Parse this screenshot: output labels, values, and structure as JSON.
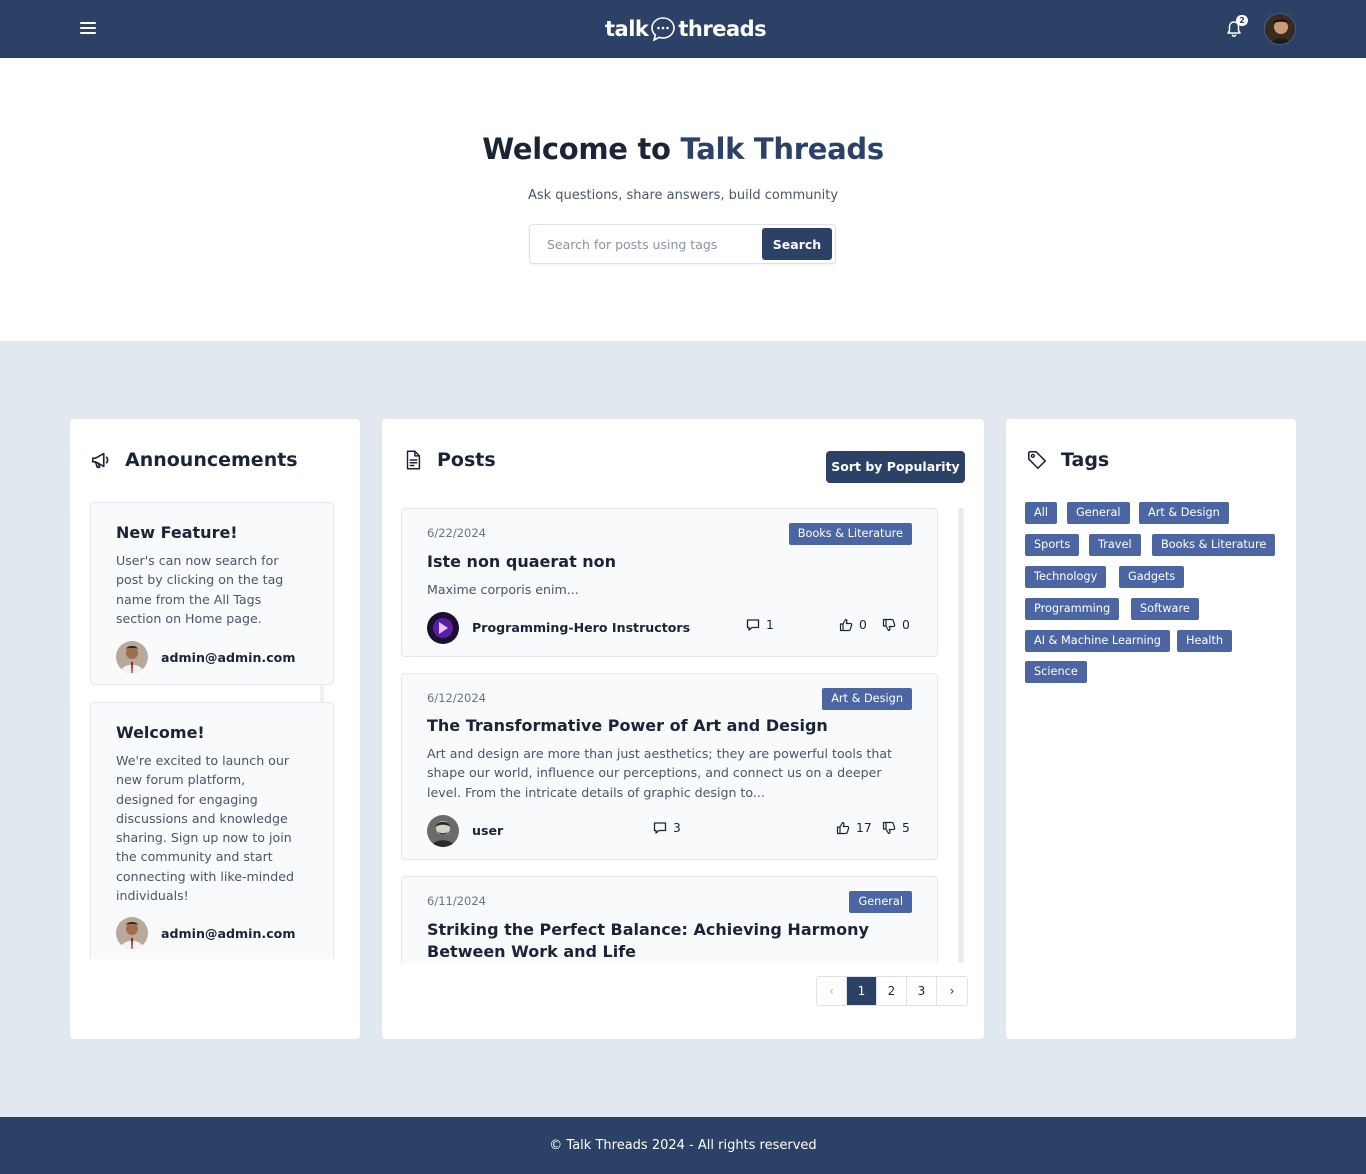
{
  "header": {
    "brand_left": "talk",
    "brand_right": "threads",
    "notification_count": "2",
    "icons": {
      "menu": "hamburger-menu-icon",
      "bell": "bell-icon"
    }
  },
  "hero": {
    "title_prefix": "Welcome to",
    "title_accent": "Talk Threads",
    "subtitle": "Ask questions, share answers, build community",
    "search_placeholder": "Search for posts using tags",
    "search_button": "Search"
  },
  "announcements": {
    "heading": "Announcements",
    "icon": "megaphone-icon",
    "items": [
      {
        "title": "New Feature!",
        "body": "User's can now search for post by clicking on the tag name from the All Tags section on Home page.",
        "author": "admin@admin.com"
      },
      {
        "title": "Welcome!",
        "body": "We're excited to launch our new forum platform, designed for engaging discussions and knowledge sharing. Sign up now to join the community and start connecting with like-minded individuals!",
        "author": "admin@admin.com"
      }
    ]
  },
  "posts": {
    "heading": "Posts",
    "icon": "document-icon",
    "sort_button": "Sort by Popularity",
    "items": [
      {
        "date": "6/22/2024",
        "tag": "Books & Literature",
        "title": "Iste non quaerat non",
        "excerpt": "Maxime corporis enim...",
        "author": "Programming-Hero Instructors",
        "comments": "1",
        "upvotes": "0",
        "downvotes": "0"
      },
      {
        "date": "6/12/2024",
        "tag": "Art & Design",
        "title": "The Transformative Power of Art and Design",
        "excerpt": "Art and design are more than just aesthetics; they are powerful tools that shape our world, influence our perceptions, and connect us on a deeper level. From the intricate details of graphic design to...",
        "author": "user",
        "comments": "3",
        "upvotes": "17",
        "downvotes": "5"
      },
      {
        "date": "6/11/2024",
        "tag": "General",
        "title": "Striking the Perfect Balance: Achieving Harmony Between Work and Life"
      }
    ],
    "pagination": {
      "prev": "‹",
      "pages": [
        "1",
        "2",
        "3"
      ],
      "next": "›",
      "current": "1"
    }
  },
  "tags": {
    "heading": "Tags",
    "icon": "tag-icon",
    "items": [
      "All",
      "General",
      "Art & Design",
      "Sports",
      "Travel",
      "Books & Literature",
      "Technology",
      "Gadgets",
      "Programming",
      "Software",
      "AI & Machine Learning",
      "Health",
      "Science"
    ]
  },
  "footer": {
    "text": "© Talk Threads 2024 - All rights reserved"
  },
  "colors": {
    "navy": "#2c4166",
    "tag_blue": "#4c66a3",
    "page_bg": "#e2e8f0"
  }
}
